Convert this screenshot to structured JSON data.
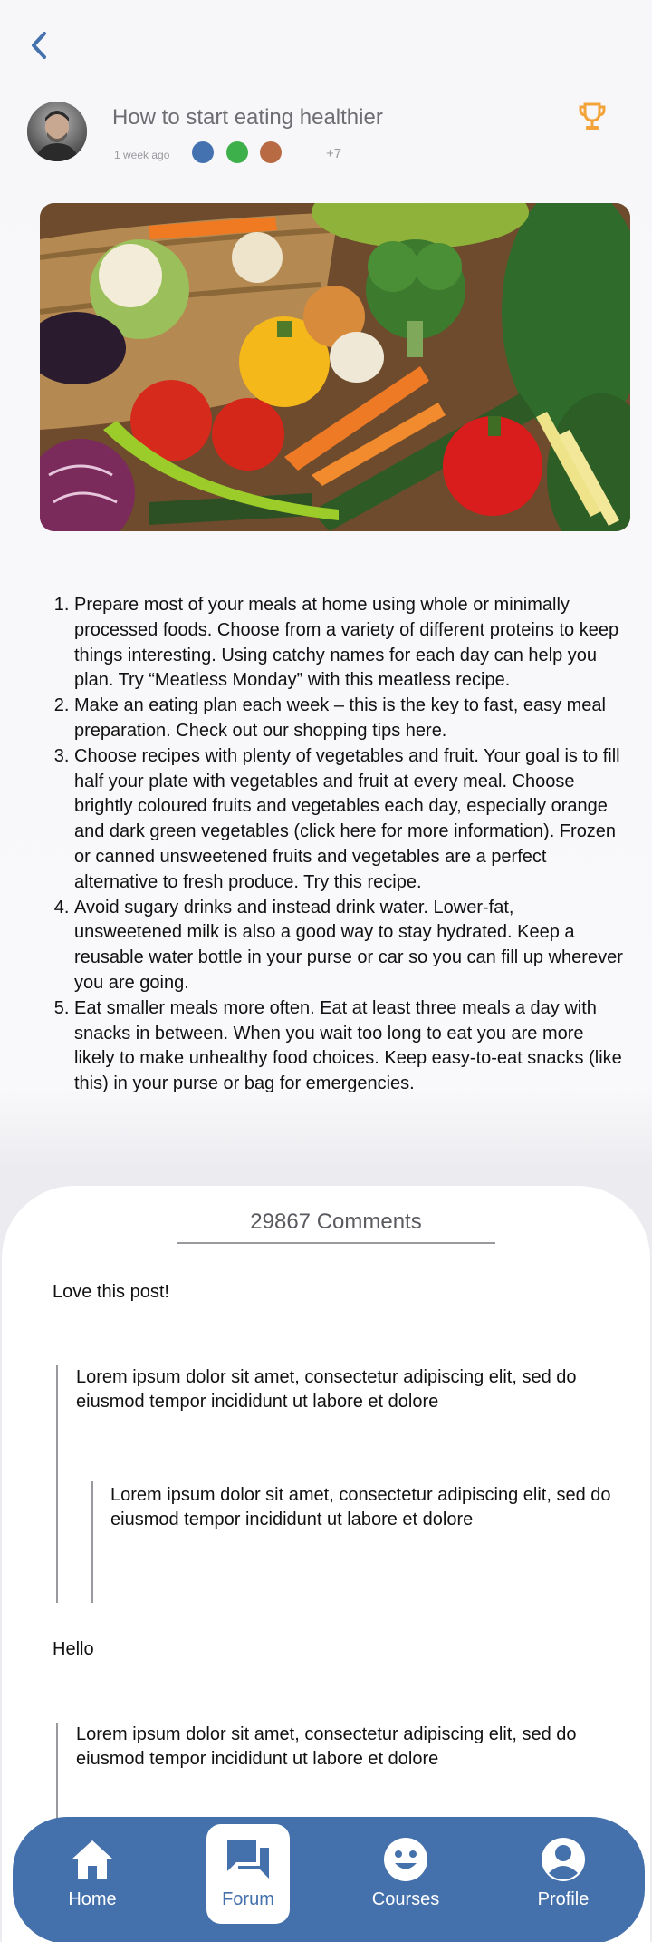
{
  "header": {
    "back_icon": "chevron-left-icon",
    "title": "How to start eating healthier",
    "time_ago": "1 week ago",
    "participant_colors": [
      "#4472b0",
      "#3db04b",
      "#b86b42"
    ],
    "more_participants": "+7",
    "trophy_icon": "trophy-icon",
    "accent_color": "#4470ac",
    "trophy_color": "#f2a33a"
  },
  "post": {
    "image_label": "vegetables-photo",
    "tips": [
      "Prepare most of your meals at home using whole or minimally processed foods. Choose from a variety of different proteins to keep things interesting. Using catchy names for each day can help you plan. Try “Meatless Monday” with this meatless recipe.",
      "Make an eating plan each week – this is the key to fast, easy meal preparation. Check out our shopping tips here.",
      "Choose recipes with plenty of vegetables and fruit. Your goal is to fill half your plate with vegetables and fruit at every meal. Choose brightly coloured fruits and vegetables each day, especially orange and dark green vegetables (click here for more information). Frozen or canned unsweetened fruits and vegetables are a perfect alternative to fresh produce. Try this recipe.",
      "Avoid sugary drinks and instead drink water. Lower-fat, unsweetened milk is also a good way to stay hydrated. Keep a reusable water bottle in your purse or car so you can fill up wherever you are going.",
      "Eat smaller meals more often. Eat at least three meals a day with snacks in between. When you wait too long to eat you are more likely to make unhealthy food choices. Keep easy-to-eat snacks (like this) in your purse or bag for emergencies."
    ]
  },
  "comments": {
    "title": "29867 Comments",
    "items": [
      "Love this post!",
      "Lorem ipsum dolor sit amet, consectetur adipiscing elit, sed do eiusmod tempor incididunt ut labore et dolore",
      "Lorem ipsum dolor sit amet, consectetur adipiscing elit, sed do eiusmod tempor incididunt ut labore et dolore",
      "Hello",
      "Lorem ipsum dolor sit amet, consectetur adipiscing elit, sed do eiusmod tempor incididunt ut labore et dolore"
    ]
  },
  "nav": {
    "items": [
      {
        "label": "Home",
        "icon": "home-icon"
      },
      {
        "label": "Forum",
        "icon": "forum-icon",
        "active": true
      },
      {
        "label": "Courses",
        "icon": "smiley-icon"
      },
      {
        "label": "Profile",
        "icon": "profile-icon"
      }
    ]
  }
}
